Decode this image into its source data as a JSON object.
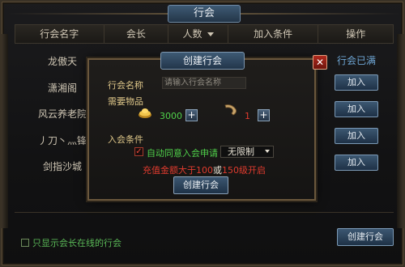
{
  "window": {
    "title": "行会"
  },
  "table": {
    "headers": [
      "行会名字",
      "会长",
      "人数",
      "加入条件",
      "操作"
    ],
    "rows": [
      {
        "name": "龙傲天"
      },
      {
        "name": "潇湘阁"
      },
      {
        "name": "风云养老院"
      },
      {
        "name": "丿刀丶灬锋"
      },
      {
        "name": "剑指沙城"
      }
    ],
    "full_status": "行会已满",
    "join_label": "加入"
  },
  "footer": {
    "online_only_label": "只显示会长在线的行会",
    "create_label": "创建行会"
  },
  "modal": {
    "title": "创建行会",
    "name_label": "行会名称",
    "name_placeholder": "请输入行会名称",
    "items_label": "需要物品",
    "gold_amount": "3000",
    "horn_amount": "1",
    "conditions_label": "入会条件",
    "auto_approve_label": "自动同意入会申请",
    "limit_value": "无限制",
    "req_part1": "充值金额大于",
    "req_amount": "100",
    "req_or": "或",
    "req_level": "150",
    "req_part2": "级开启",
    "create_label": "创建行会",
    "close_symbol": "✕"
  },
  "colors": {
    "accent_blue": "#3c5771",
    "green_text": "#4fd14a",
    "red_text": "#e03b2e",
    "gold_label": "#e0c88a"
  },
  "icons": [
    "gold-ingot-icon",
    "horn-icon",
    "plus-icon",
    "close-icon",
    "checkbox-icon",
    "dropdown-caret-icon"
  ]
}
